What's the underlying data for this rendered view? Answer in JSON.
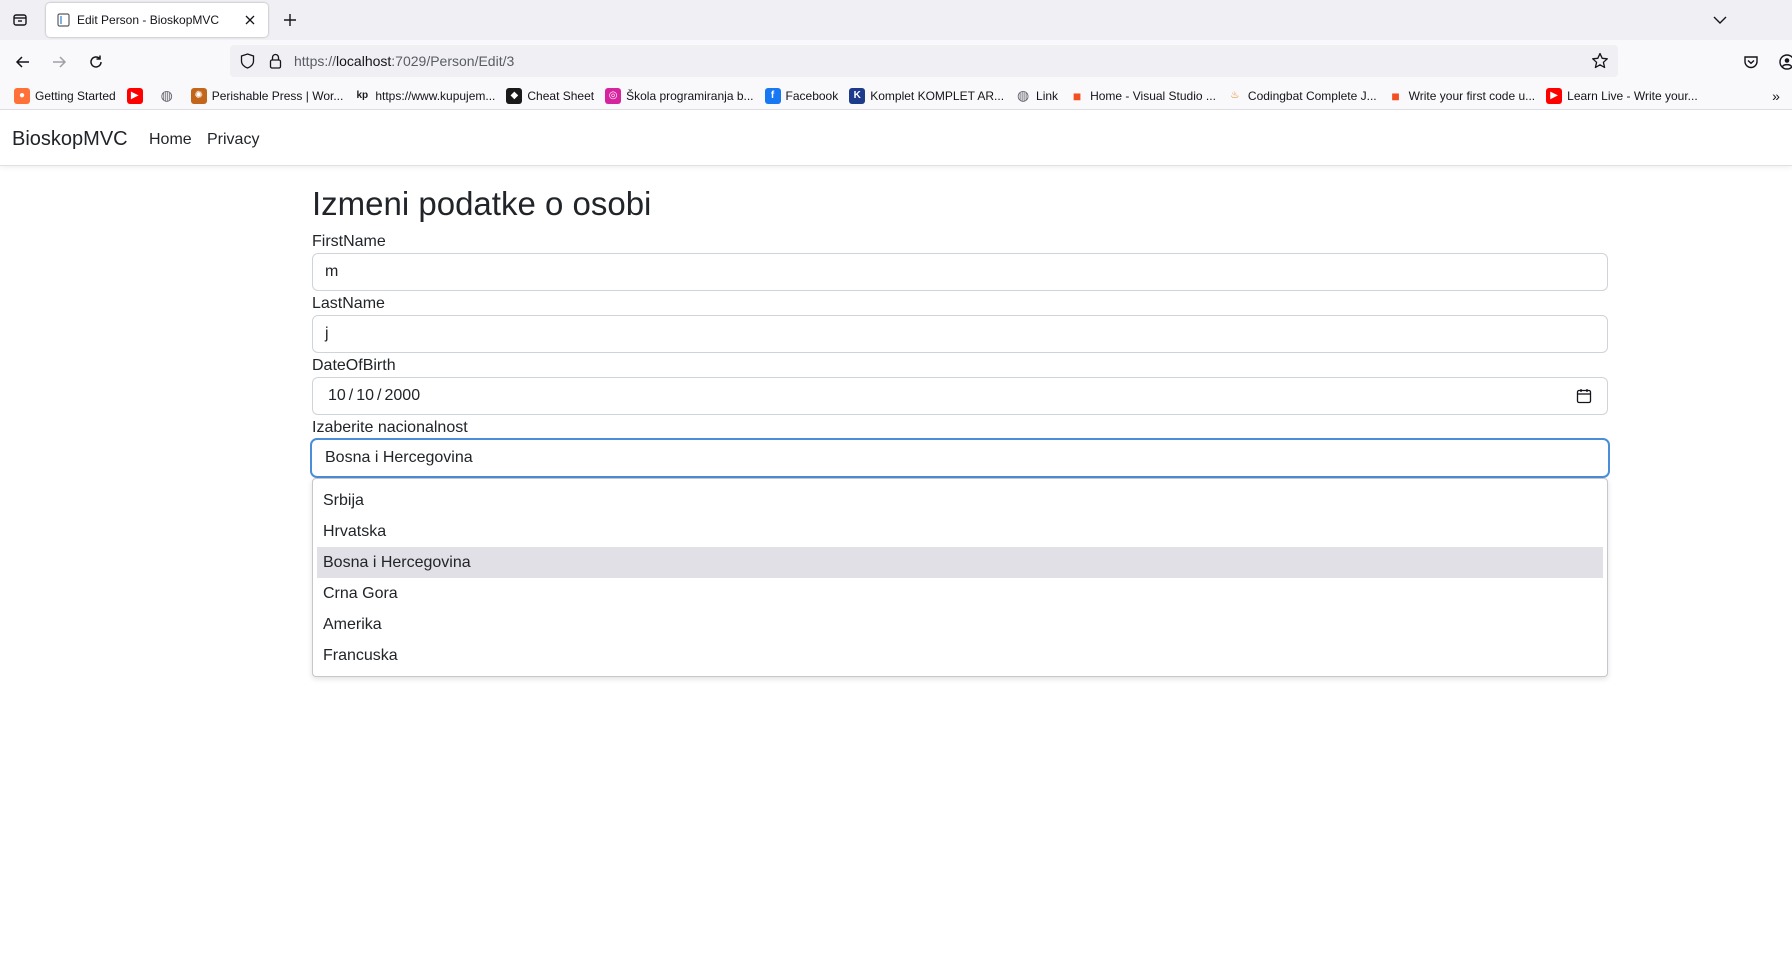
{
  "browser": {
    "tab_title": "Edit Person - BioskopMVC",
    "url_prefix": "https://",
    "url_host": "localhost",
    "url_rest": ":7029/Person/Edit/3",
    "bookmarks": [
      {
        "label": "Getting Started",
        "icon": "firefox-icon",
        "color": "#ff7139"
      },
      {
        "label": "",
        "icon": "youtube-icon",
        "color": "#ff0000"
      },
      {
        "label": "",
        "icon": "globe-icon",
        "color": "#5b5b66"
      },
      {
        "label": "Perishable Press | Wor...",
        "icon": "perishable-icon",
        "color": "#c2661b"
      },
      {
        "label": "https://www.kupujem...",
        "icon": "kp-icon",
        "color": "#1a1a1a"
      },
      {
        "label": "Cheat Sheet",
        "icon": "cheatsheet-icon",
        "color": "#1a1a1a"
      },
      {
        "label": "Škola programiranja b...",
        "icon": "instagram-icon",
        "color": "#d6249f"
      },
      {
        "label": "Facebook",
        "icon": "facebook-icon",
        "color": "#1877f2"
      },
      {
        "label": "Komplet KOMPLET AR...",
        "icon": "komplet-icon",
        "color": "#1e3a8a"
      },
      {
        "label": "Link",
        "icon": "globe-icon",
        "color": "#5b5b66"
      },
      {
        "label": "Home - Visual Studio ...",
        "icon": "microsoft-icon",
        "color": "#f25022"
      },
      {
        "label": "Codingbat Complete J...",
        "icon": "java-icon",
        "color": "#e76f00"
      },
      {
        "label": "Write your first code u...",
        "icon": "microsoft-icon",
        "color": "#f25022"
      },
      {
        "label": "Learn Live - Write your...",
        "icon": "youtube-icon",
        "color": "#ff0000"
      }
    ]
  },
  "site": {
    "brand": "BioskopMVC",
    "nav": [
      "Home",
      "Privacy"
    ]
  },
  "form": {
    "title": "Izmeni podatke o osobi",
    "first_name_label": "FirstName",
    "first_name_value": "m",
    "last_name_label": "LastName",
    "last_name_value": "j",
    "dob_label": "DateOfBirth",
    "dob_month": "10",
    "dob_day": "10",
    "dob_year": "2000",
    "dob_sep": "/",
    "nationality_label": "Izaberite nacionalnost",
    "nationality_value": "Bosna i Hercegovina",
    "nationality_options": [
      "Srbija",
      "Hrvatska",
      "Bosna i Hercegovina",
      "Crna Gora",
      "Amerika",
      "Francuska"
    ],
    "selected_index": 2
  }
}
